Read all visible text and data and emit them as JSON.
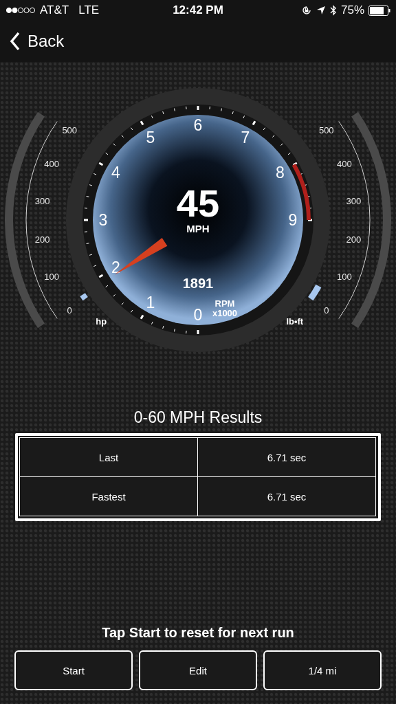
{
  "status_bar": {
    "carrier": "AT&T",
    "network": "LTE",
    "time": "12:42 PM",
    "battery": "75%"
  },
  "nav": {
    "back": "Back"
  },
  "tachometer": {
    "labels": [
      "0",
      "1",
      "2",
      "3",
      "4",
      "5",
      "6",
      "7",
      "8",
      "9"
    ],
    "speed": "45",
    "speed_unit": "MPH",
    "rpm": "1891",
    "rpm_unit": "RPM",
    "rpm_scale": "x1000"
  },
  "side_gauges": [
    {
      "unit": "hp",
      "ticks": [
        "0",
        "100",
        "200",
        "300",
        "400",
        "500"
      ]
    },
    {
      "unit": "lb•ft",
      "ticks": [
        "0",
        "100",
        "200",
        "300",
        "400",
        "500"
      ]
    }
  ],
  "results": {
    "title": "0-60 MPH Results",
    "rows": [
      {
        "label": "Last",
        "value": "6.71 sec"
      },
      {
        "label": "Fastest",
        "value": "6.71 sec"
      }
    ]
  },
  "prompt": "Tap Start to reset for next run",
  "buttons": [
    "Start",
    "Edit",
    "1/4 mi"
  ]
}
